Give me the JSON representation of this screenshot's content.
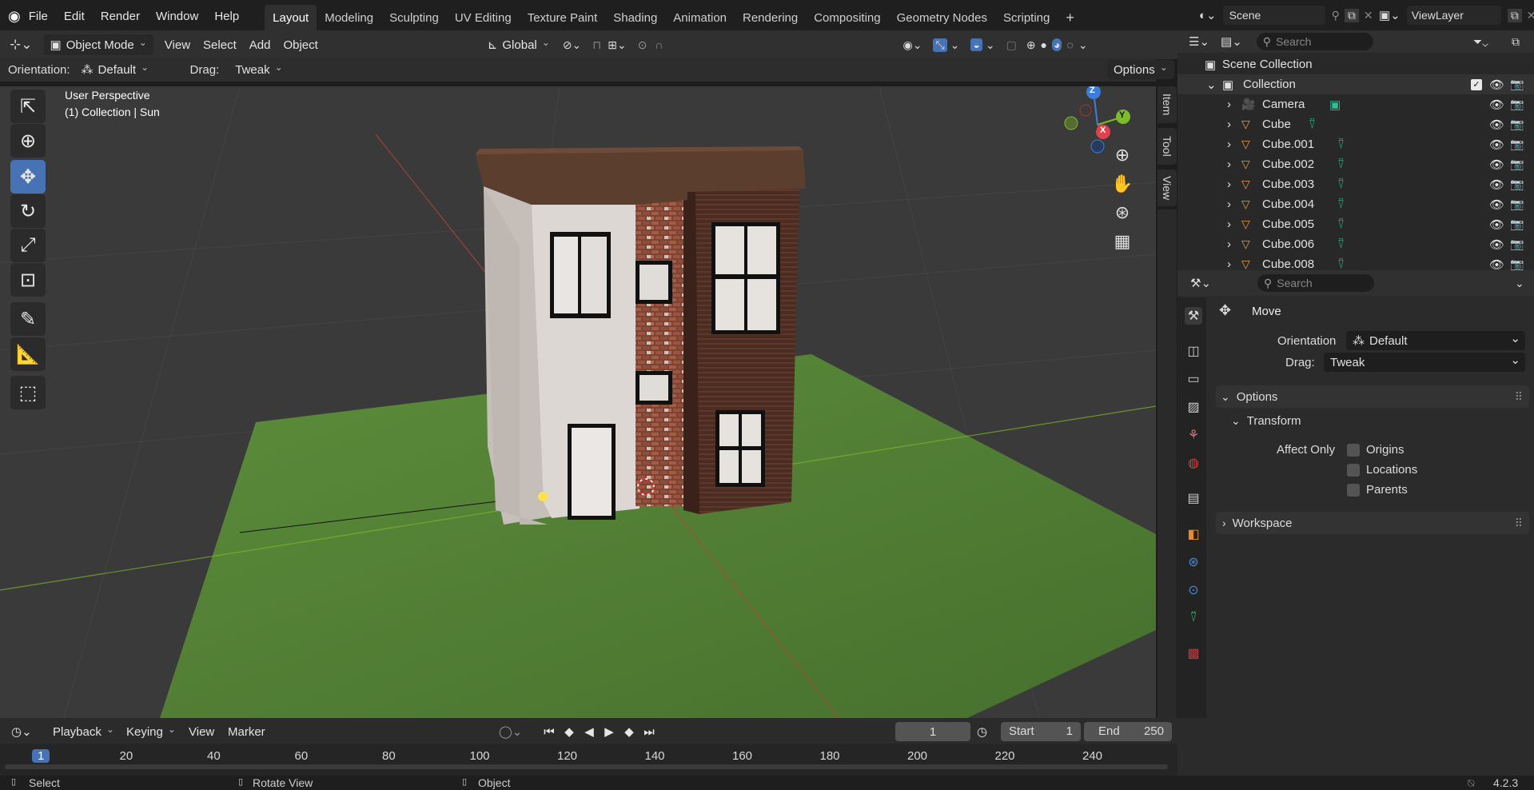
{
  "topbar": {
    "menus": [
      "File",
      "Edit",
      "Render",
      "Window",
      "Help"
    ],
    "workspaces": [
      "Layout",
      "Modeling",
      "Sculpting",
      "UV Editing",
      "Texture Paint",
      "Shading",
      "Animation",
      "Rendering",
      "Compositing",
      "Geometry Nodes",
      "Scripting"
    ],
    "active_workspace": "Layout",
    "add_tab": "+",
    "scene": "Scene",
    "view_layer": "ViewLayer"
  },
  "viewport_header": {
    "mode": "Object Mode",
    "menus": [
      "View",
      "Select",
      "Add",
      "Object"
    ],
    "transform_orientation": "Global"
  },
  "tool_header": {
    "orientation_label": "Orientation:",
    "orientation_value": "Default",
    "drag_label": "Drag:",
    "drag_value": "Tweak",
    "options_label": "Options"
  },
  "viewport": {
    "perspective_text": "User Perspective",
    "collection_text": "(1) Collection | Sun",
    "side_tabs": [
      "Item",
      "Tool",
      "View"
    ],
    "gizmo_axes": [
      "Z",
      "Y",
      "X"
    ],
    "colors": {
      "x_axis": "#e0424d",
      "y_axis": "#7dbb2a",
      "z_axis": "#3b7dd8",
      "grass": "#4f7a34",
      "brick": "#6a3a2c",
      "roof": "#5c3e2e",
      "wall": "#d9d3cf",
      "active_tool": "#4772b3"
    }
  },
  "tools": [
    "select-box-icon",
    "cursor-icon",
    "move-icon",
    "rotate-icon",
    "scale-icon",
    "transform-icon",
    "annotate-icon",
    "measure-icon",
    "add-cube-icon"
  ],
  "outliner": {
    "search_placeholder": "Search",
    "scene_collection": "Scene Collection",
    "collection": "Collection",
    "items": [
      "Camera",
      "Cube",
      "Cube.001",
      "Cube.002",
      "Cube.003",
      "Cube.004",
      "Cube.005",
      "Cube.006",
      "Cube.008"
    ]
  },
  "properties": {
    "search_placeholder": "Search",
    "tool_name": "Move",
    "orientation_label": "Orientation",
    "orientation_value": "Default",
    "drag_label": "Drag:",
    "drag_value": "Tweak",
    "options_panel": "Options",
    "transform_panel": "Transform",
    "affect_only_label": "Affect Only",
    "checkboxes": [
      "Origins",
      "Locations",
      "Parents"
    ],
    "workspace_panel": "Workspace"
  },
  "timeline": {
    "menus": [
      "Playback",
      "Keying",
      "View",
      "Marker"
    ],
    "current_frame": "1",
    "start_label": "Start",
    "start_value": "1",
    "end_label": "End",
    "end_value": "250",
    "ticks": [
      "1",
      "20",
      "40",
      "60",
      "80",
      "100",
      "120",
      "140",
      "160",
      "180",
      "200",
      "220",
      "240"
    ]
  },
  "statusbar": {
    "select": "Select",
    "rotate": "Rotate View",
    "object": "Object",
    "version": "4.2.3"
  }
}
